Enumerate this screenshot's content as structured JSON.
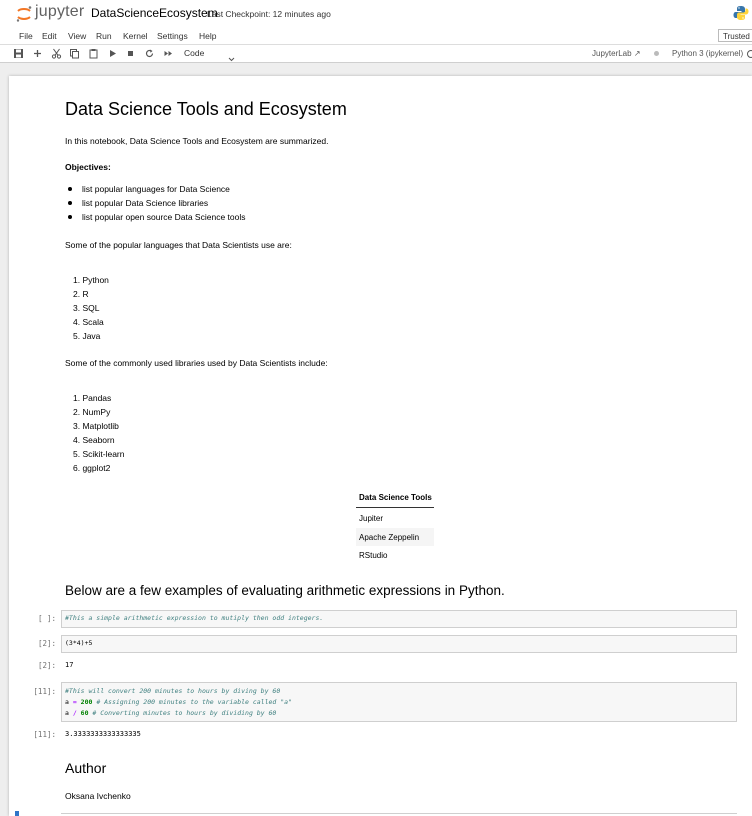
{
  "header": {
    "logo_text": "jupyter",
    "notebook_title": "DataScienceEcosystem",
    "checkpoint": "Last Checkpoint: 12 minutes ago",
    "trusted": "Trusted"
  },
  "menu": [
    "File",
    "Edit",
    "View",
    "Run",
    "Kernel",
    "Settings",
    "Help"
  ],
  "toolbar": {
    "cell_type": "Code",
    "jupyterlab": "JupyterLab",
    "kernel": "Python 3 (ipykernel)"
  },
  "notebook": {
    "title": "Data Science Tools and Ecosystem",
    "intro": "In this notebook, Data Science Tools and Ecosystem are summarized.",
    "objectives_label": "Objectives:",
    "objectives": [
      "list popular languages for Data Science",
      "list popular Data Science libraries",
      "list popular open source Data Science tools"
    ],
    "languages_intro": "Some of the popular languages that Data Scientists use are:",
    "languages": [
      "1. Python",
      "2. R",
      "3. SQL",
      "4. Scala",
      "5. Java"
    ],
    "libraries_intro": "Some of the commonly used libraries used by Data Scientists include:",
    "libraries": [
      "1. Pandas",
      "2. NumPy",
      "3. Matplotlib",
      "4. Seaborn",
      "5. Scikit-learn",
      "6. ggplot2"
    ],
    "tools_table": {
      "header": "Data Science Tools",
      "rows": [
        "Jupiter",
        "Apache Zeppelin",
        "RStudio"
      ]
    },
    "arith_heading": "Below are a few examples of evaluating arithmetic expressions in Python.",
    "cells": {
      "c1_prompt": "[ ]:",
      "c1_comment": "#This a simple arithmetic expression to mutiply then odd integers.",
      "c2_prompt": "[2]:",
      "c2_code": "(3*4)+5",
      "c2_out_prompt": "[2]:",
      "c2_output": "17",
      "c3_prompt": "[11]:",
      "c3_line1": "#This will convert 200 minutes to hours by diving by 60",
      "c3_l2_var": "a ",
      "c3_l2_op": "=",
      "c3_l2_num": " 200",
      "c3_l2_comment": " # Assigning 200 minutes to the variable called \"a\"",
      "c3_l3_var": "a ",
      "c3_l3_op": "/",
      "c3_l3_num": " 60",
      "c3_l3_comment": " # Converting minutes to hours by dividing by 60",
      "c3_out_prompt": "[11]:",
      "c3_output": "3.3333333333333335"
    },
    "author_heading": "Author",
    "author_name": "Oksana Ivchenko"
  },
  "colors": {
    "jupyter_orange": "#f37726",
    "comment": "#408080",
    "number": "#008000",
    "operator": "#aa22ff"
  }
}
